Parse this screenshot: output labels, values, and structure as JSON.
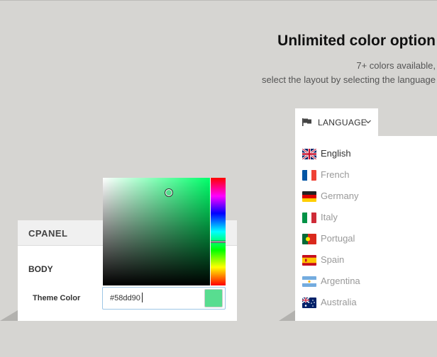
{
  "hero": {
    "title": "Unlimited color option",
    "line1": "7+ colors available,",
    "line2": "select the layout by selecting the language"
  },
  "cpanel": {
    "title": "CPANEL",
    "section": "BODY",
    "theme_color_label": "Theme Color",
    "theme_color_value": "#58dd90",
    "swatch_color": "#58dd90"
  },
  "color_picker": {
    "hue_icon": "hue-slider",
    "cursor_icon": "saturation-cursor"
  },
  "language": {
    "label": "LANGUAGE",
    "icon": "flag-icon",
    "dropdown_icon": "chevron-down-icon",
    "items": [
      {
        "name": "English",
        "flag": "uk-flag-icon",
        "active": true
      },
      {
        "name": "French",
        "flag": "france-flag-icon",
        "active": false
      },
      {
        "name": "Germany",
        "flag": "germany-flag-icon",
        "active": false
      },
      {
        "name": "Italy",
        "flag": "italy-flag-icon",
        "active": false
      },
      {
        "name": "Portugal",
        "flag": "portugal-flag-icon",
        "active": false
      },
      {
        "name": "Spain",
        "flag": "spain-flag-icon",
        "active": false
      },
      {
        "name": "Argentina",
        "flag": "argentina-flag-icon",
        "active": false
      },
      {
        "name": "Australia",
        "flag": "australia-flag-icon",
        "active": false
      }
    ]
  }
}
